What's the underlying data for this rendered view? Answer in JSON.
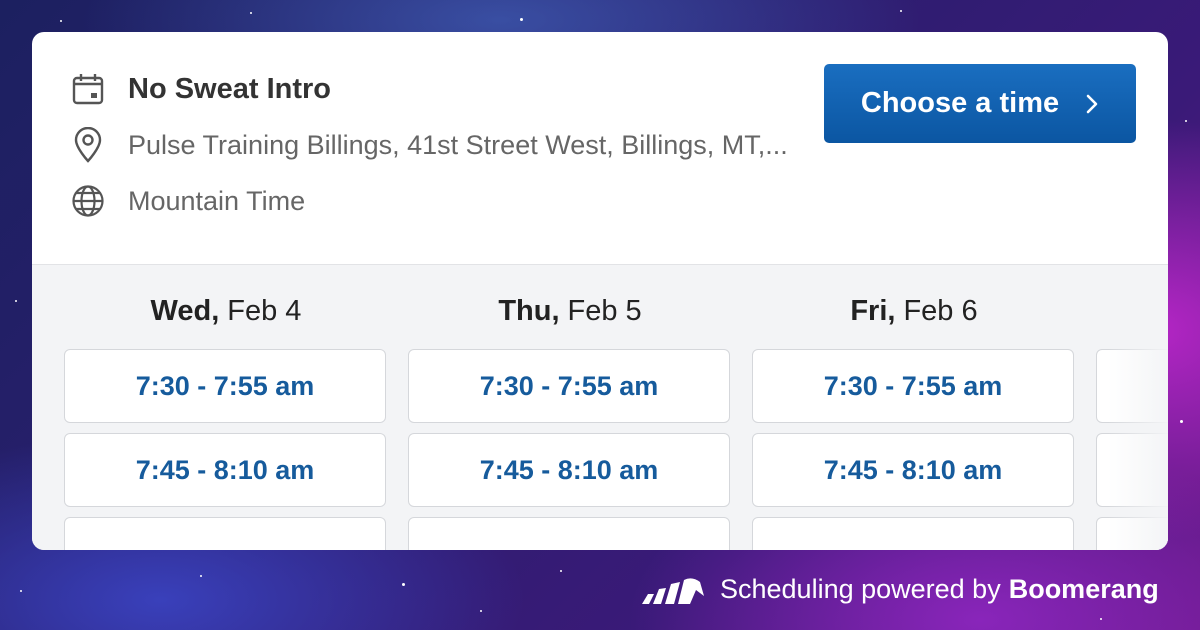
{
  "event": {
    "title": "No Sweat Intro",
    "location": "Pulse Training Billings, 41st Street West, Billings, MT,...",
    "timezone": "Mountain Time",
    "choose_button": "Choose a time"
  },
  "days": [
    {
      "weekday": "Wed,",
      "date": "Feb 4",
      "slots": [
        "7:30 - 7:55 am",
        "7:45 - 8:10 am"
      ]
    },
    {
      "weekday": "Thu,",
      "date": "Feb 5",
      "slots": [
        "7:30 - 7:55 am",
        "7:45 - 8:10 am"
      ]
    },
    {
      "weekday": "Fri,",
      "date": "Feb 6",
      "slots": [
        "7:30 - 7:55 am",
        "7:45 - 8:10 am"
      ]
    }
  ],
  "footer": {
    "prefix": "Scheduling powered by",
    "brand": "Boomerang"
  },
  "colors": {
    "accent": "#0b56a2",
    "slot_text": "#165b9c"
  },
  "icons": [
    "calendar-icon",
    "location-pin-icon",
    "globe-icon",
    "chevron-right-icon",
    "boomerang-logo-icon"
  ]
}
